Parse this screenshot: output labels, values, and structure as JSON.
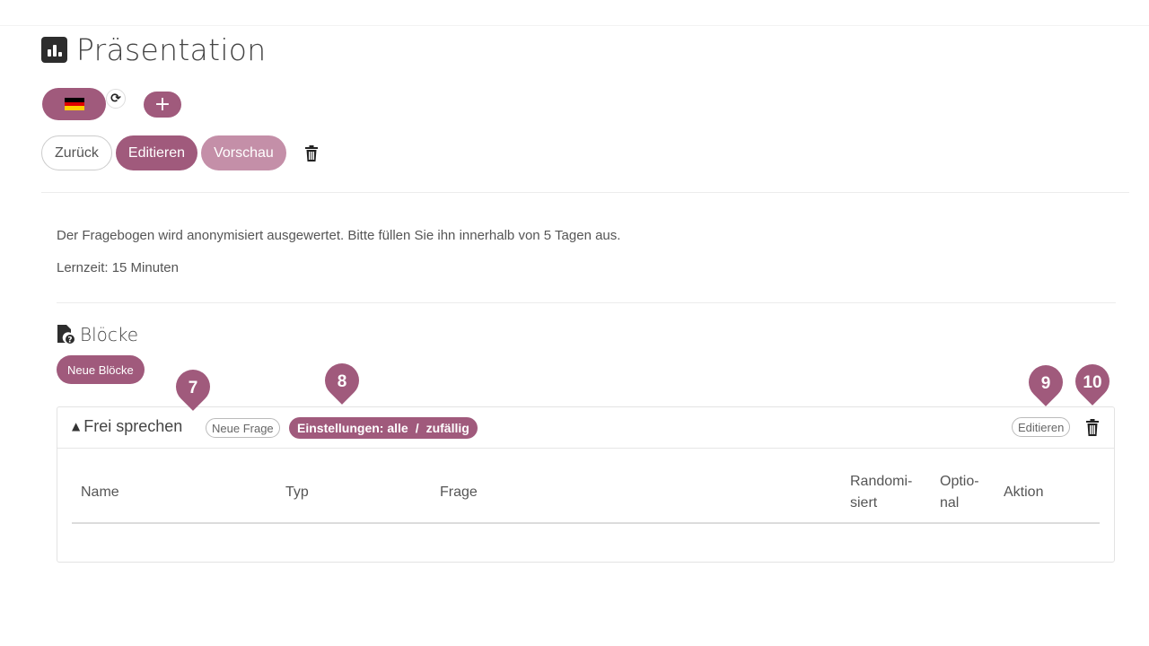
{
  "page": {
    "title": "Präsentation"
  },
  "toolbar": {
    "back_label": "Zurück",
    "edit_label": "Editieren",
    "preview_label": "Vorschau",
    "add_label": "+"
  },
  "language": {
    "flag": "de-flag",
    "refresh_icon": "refresh-icon"
  },
  "description": {
    "text": "Der Fragebogen wird anonymisiert ausgewertet. Bitte füllen Sie ihn innerhalb von 5 Tagen aus.",
    "study_time": "Lernzeit: 15 Minuten"
  },
  "blocks_section": {
    "title": "Blöcke",
    "new_blocks_label": "Neue Blöcke",
    "block": {
      "name": "Frei sprechen",
      "new_question_label": "Neue Frage",
      "settings_prefix": "Einstellungen: alle",
      "settings_separator": "/",
      "settings_suffix": "zufällig",
      "edit_label": "Editieren",
      "columns": {
        "name": "Name",
        "type": "Typ",
        "question": "Frage",
        "randomized_1": "Randomi-",
        "randomized_2": "siert",
        "optional_1": "Optio-",
        "optional_2": "nal",
        "action": "Aktion"
      }
    }
  },
  "markers": [
    "7",
    "8",
    "9",
    "10"
  ],
  "colors": {
    "primary": "#a05a7c",
    "primary_light": "#c48fa8"
  }
}
